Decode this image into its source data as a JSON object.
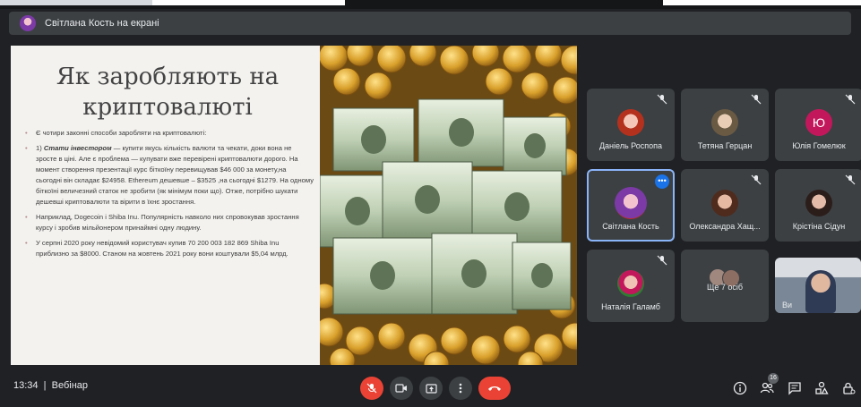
{
  "presenter": {
    "text": "Світлана Кость на екрані"
  },
  "slide": {
    "title": "Як заробляють на криптовалюті",
    "bullets": [
      "Є чотири  законні способи заробляти на криптовалюті:",
      "не зросте в ціні. Але є проблема — купувати вже перевірені криптовалюти дорого. На момент створення презентації  курс біткоїну перевищував $46 000 за монету,на сьогодні він складає  $24958. Ethereum дешевше – $3525 ,на сьогодні $1279. На одному біткоїні величезний статок не зробити (як мінімум поки що). Отже, потрібно шукати дешевші криптовалюти та вірити в їхнє зростання.",
      "Наприклад, Dogecoin і Shiba Inu. Популярність  навколо них спровокував зростання курсу і зробив мільйонером принаймні одну людину.",
      "У серпні 2020 року невідомий користувач купив 70 200 003 182 869 Shiba Inu приблизно за $8000. Станом на жовтень 2021 року вони коштували $5,04 млрд."
    ],
    "b1_prefix": "1) ",
    "b1_bold": "Стати інвестором",
    "b1_rest": " — купити якусь кількість валюти та чекати, доки вона"
  },
  "participants": [
    {
      "name": "Даніель Роспопа",
      "muted": true
    },
    {
      "name": "Тетяна Герцан",
      "muted": true
    },
    {
      "name": "Юлія Гомелюк",
      "muted": true,
      "initial": "Ю",
      "color": "#c2185b"
    },
    {
      "name": "Світлана Кость",
      "muted": false,
      "active": true
    },
    {
      "name": "Олександра Хащ...",
      "muted": true
    },
    {
      "name": "Крістіна Сідун",
      "muted": true
    },
    {
      "name": "Наталія Галамб",
      "muted": true
    },
    {
      "name": "Ще 7 осіб"
    },
    {
      "name": "Ви"
    }
  ],
  "more_menu": "•••",
  "bottom": {
    "time": "13:34",
    "meeting": "Вебінар",
    "people_count": "16"
  },
  "icons": [
    "mic-off-icon",
    "camera-icon",
    "present-icon",
    "more-vert-icon",
    "hangup-icon",
    "info-icon",
    "people-icon",
    "chat-icon",
    "activities-icon",
    "host-controls-icon"
  ],
  "colors": {
    "bg": "#202124",
    "tile": "#3c4043",
    "red": "#ea4335",
    "blue": "#1a73e8"
  }
}
